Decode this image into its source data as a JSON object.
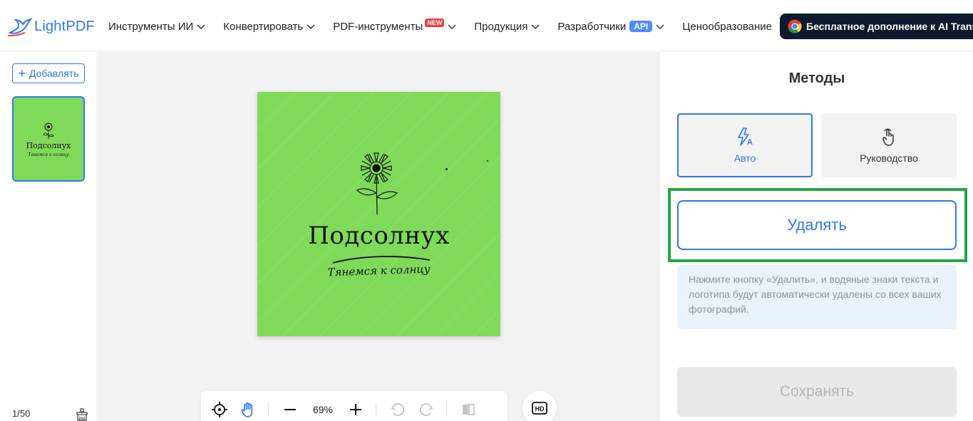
{
  "header": {
    "logo_text": "LightPDF",
    "nav": [
      {
        "label": "Инструменты ИИ"
      },
      {
        "label": "Конвертировать"
      },
      {
        "label": "PDF-инструменты",
        "badge": "NEW"
      },
      {
        "label": "Продукция"
      },
      {
        "label": "Разработчики",
        "badge": "API"
      },
      {
        "label": "Ценообразование"
      }
    ],
    "extension_label": "Бесплатное дополнение к AI Trans"
  },
  "left_panel": {
    "add_label": "Добавлять",
    "thumb_title": "Подсолнух",
    "thumb_subtitle": "Тянемся к солнцу",
    "page_count": "1/50"
  },
  "canvas": {
    "image_title": "Подсолнух",
    "image_subtitle": "Тянемся к солнцу",
    "zoom": "69%"
  },
  "right_panel": {
    "title": "Методы",
    "methods": [
      {
        "label": "Авто",
        "icon": "auto-flash-icon",
        "selected": true
      },
      {
        "label": "Руководство",
        "icon": "hand-pointer-icon",
        "selected": false
      }
    ],
    "remove_label": "Удалять",
    "hint": "Нажмите кнопку «Удалить», и водяные знаки текста и логотипа будут автоматически удалены со всех ваших фотографий.",
    "save_label": "Сохранять"
  },
  "colors": {
    "accent": "#2f78ef",
    "highlight": "#22a646",
    "image_bg": "#7fda5a",
    "ext_bg": "#0f1a2e"
  }
}
